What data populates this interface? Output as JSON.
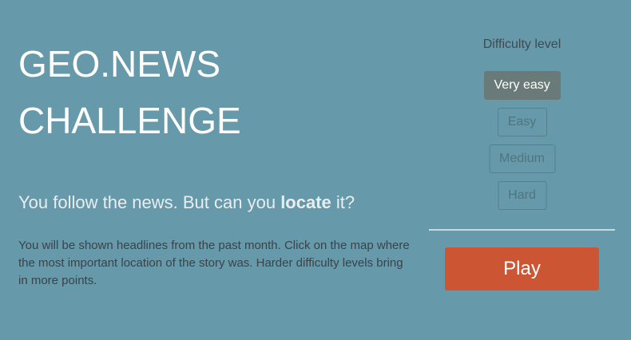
{
  "intro": {
    "title_line1": "GEO.NEWS",
    "title_line2": "CHALLENGE",
    "tagline_prefix": "You follow the news. But can you ",
    "tagline_bold": "locate",
    "tagline_suffix": " it?",
    "description": "You will be shown headlines from the past month. Click on the map where the most important location of the story was. Harder difficulty levels bring in more points."
  },
  "difficulty": {
    "label": "Difficulty level",
    "selected": "Very easy",
    "options": [
      "Very easy",
      "Easy",
      "Medium",
      "Hard"
    ]
  },
  "play_label": "Play",
  "colors": {
    "background": "#6699aa",
    "play_button": "#cc5533",
    "selected_level": "#6a7a78"
  }
}
